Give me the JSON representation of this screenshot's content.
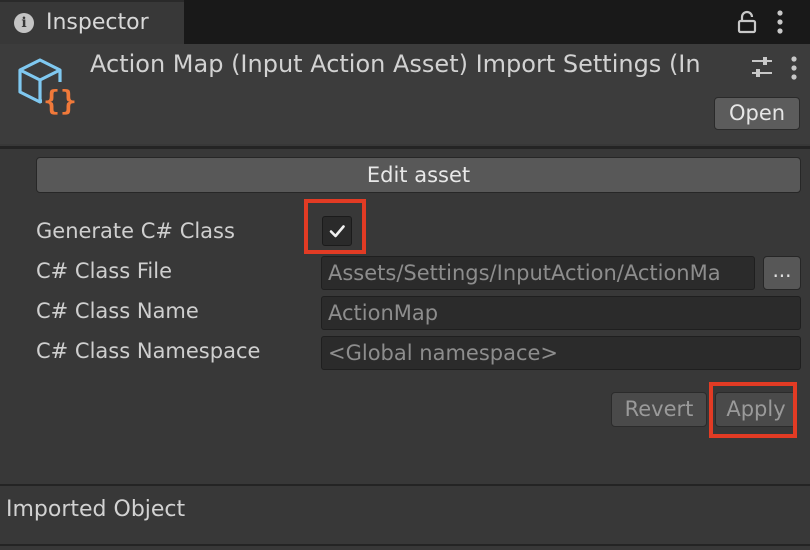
{
  "tab": {
    "title": "Inspector",
    "icon": "info-icon"
  },
  "header": {
    "title": "Action Map (Input Action Asset) Import Settings (In",
    "open_label": "Open",
    "icon": "input-action-asset-icon",
    "icon_colors": {
      "cube": "#7fc8f0",
      "braces": "#f0793a"
    }
  },
  "edit_asset_label": "Edit asset",
  "form": {
    "generate": {
      "label": "Generate C# Class",
      "checked": true
    },
    "file": {
      "label": "C# Class File",
      "value": "Assets/Settings/InputAction/ActionMa",
      "browse_label": "..."
    },
    "name": {
      "label": "C# Class Name",
      "value": "ActionMap"
    },
    "namespace": {
      "label": "C# Class Namespace",
      "value": "<Global namespace>"
    }
  },
  "buttons": {
    "revert_label": "Revert",
    "apply_label": "Apply"
  },
  "imported_object": {
    "title": "Imported Object"
  },
  "highlight_color": "#e23b24"
}
